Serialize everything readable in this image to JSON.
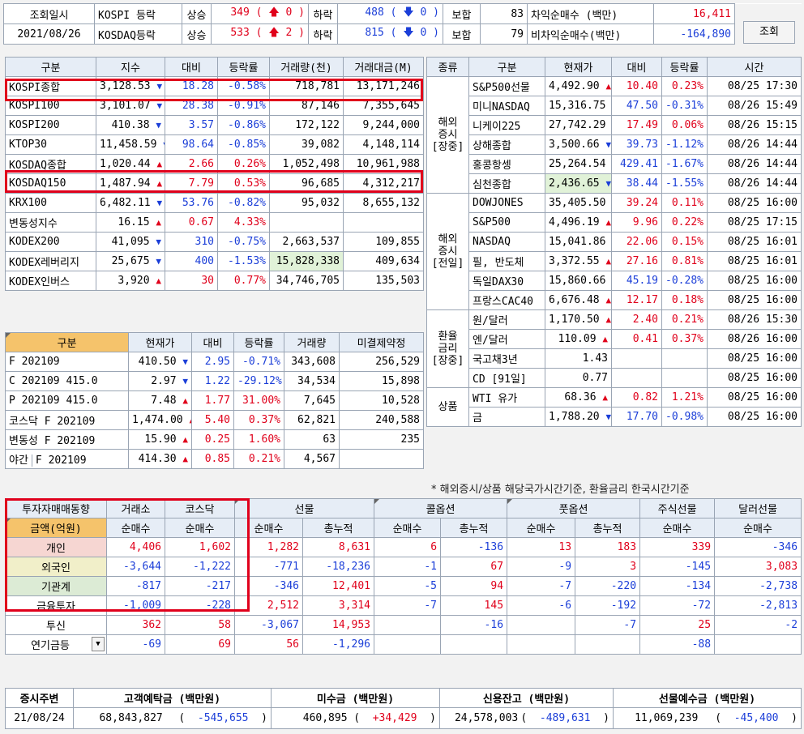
{
  "top": {
    "rows": [
      {
        "label": "조회일시",
        "name": "KOSPI 등락",
        "up_label": "상승",
        "up": "349",
        "up_ch": "0",
        "down_label": "하락",
        "down": "488",
        "down_ch": "0",
        "flat_label": "보합",
        "flat": "83",
        "arb_label": "차익순매수 (백만)",
        "arb": "16,411"
      },
      {
        "label": "2021/08/26",
        "name": "KOSDAQ등락",
        "up_label": "상승",
        "up": "533",
        "up_ch": "2",
        "down_label": "하락",
        "down": "815",
        "down_ch": "0",
        "flat_label": "보합",
        "flat": "79",
        "arb_label": "비차익순매수(백만)",
        "arb": "-164,890"
      }
    ],
    "query_btn": "조회"
  },
  "idx": {
    "headers": [
      "구분",
      "지수",
      "대비",
      "등락률",
      "거래량(천)",
      "거래대금(M)"
    ],
    "rows": [
      {
        "n": "KOSPI종합",
        "v": "3,128.53",
        "d": "dn",
        "c": "18.28",
        "r": "-0.58%",
        "vol": "718,781",
        "amt": "13,171,246"
      },
      {
        "n": "KOSPI100",
        "v": "3,101.07",
        "d": "dn",
        "c": "28.38",
        "r": "-0.91%",
        "vol": "87,146",
        "amt": "7,355,645"
      },
      {
        "n": "KOSPI200",
        "v": "410.38",
        "d": "dn",
        "c": "3.57",
        "r": "-0.86%",
        "vol": "172,122",
        "amt": "9,244,000"
      },
      {
        "n": "KTOP30",
        "v": "11,458.59",
        "d": "dn",
        "c": "98.64",
        "r": "-0.85%",
        "vol": "39,082",
        "amt": "4,148,114"
      },
      {
        "n": "KOSDAQ종합",
        "v": "1,020.44",
        "d": "up",
        "c": "2.66",
        "r": "0.26%",
        "vol": "1,052,498",
        "amt": "10,961,988"
      },
      {
        "n": "KOSDAQ150",
        "v": "1,487.94",
        "d": "up",
        "c": "7.79",
        "r": "0.53%",
        "vol": "96,685",
        "amt": "4,312,217"
      },
      {
        "n": "KRX100",
        "v": "6,482.11",
        "d": "dn",
        "c": "53.76",
        "r": "-0.82%",
        "vol": "95,032",
        "amt": "8,655,132"
      },
      {
        "n": "변동성지수",
        "v": "16.15",
        "d": "up",
        "c": "0.67",
        "r": "4.33%",
        "vol": "",
        "amt": ""
      },
      {
        "n": "KODEX200",
        "v": "41,095",
        "d": "dn",
        "c": "310",
        "r": "-0.75%",
        "vol": "2,663,537",
        "amt": "109,855"
      },
      {
        "n": "KODEX레버리지",
        "v": "25,675",
        "d": "dn",
        "c": "400",
        "r": "-1.53%",
        "vol": "15,828,338",
        "amt": "409,634"
      },
      {
        "n": "KODEX인버스",
        "v": "3,920",
        "d": "up",
        "c": "30",
        "r": "0.77%",
        "vol": "34,746,705",
        "amt": "135,503"
      }
    ]
  },
  "fut": {
    "headers": [
      "구분",
      "현재가",
      "대비",
      "등락률",
      "거래량",
      "미결제약정"
    ],
    "rows": [
      {
        "n": "F 202109",
        "v": "410.50",
        "d": "dn",
        "c": "2.95",
        "r": "-0.71%",
        "vol": "343,608",
        "oi": "256,529"
      },
      {
        "n": "C 202109 415.0",
        "v": "2.97",
        "d": "dn",
        "c": "1.22",
        "r": "-29.12%",
        "vol": "34,534",
        "oi": "15,898"
      },
      {
        "n": "P 202109 415.0",
        "v": "7.48",
        "d": "up",
        "c": "1.77",
        "r": "31.00%",
        "vol": "7,645",
        "oi": "10,528"
      },
      {
        "n": "코스닥 F 202109",
        "v": "1,474.00",
        "d": "up",
        "c": "5.40",
        "r": "0.37%",
        "vol": "62,821",
        "oi": "240,588"
      },
      {
        "n": "변동성 F 202109",
        "v": "15.90",
        "d": "up",
        "c": "0.25",
        "r": "1.60%",
        "vol": "63",
        "oi": "235"
      },
      {
        "n0": "야간",
        "n": "F 202109",
        "v": "414.30",
        "d": "up",
        "c": "0.85",
        "r": "0.21%",
        "vol": "4,567",
        "oi": ""
      }
    ]
  },
  "world": {
    "headers": [
      "종류",
      "구분",
      "현재가",
      "대비",
      "등락률",
      "시간"
    ],
    "groups": [
      {
        "g": "해외\n증시\n[장중]",
        "span": 6
      },
      {
        "g": "해외\n증시\n[전일]",
        "span": 6
      },
      {
        "g": "환율\n금리\n[장중]",
        "span": 4
      },
      {
        "g": "상품",
        "span": 2
      }
    ],
    "rows": [
      {
        "n": "S&P500선물",
        "v": "4,492.90",
        "d": "up",
        "c": "10.40",
        "r": "0.23%",
        "t": "08/25 17:30"
      },
      {
        "n": "미니NASDAQ",
        "v": "15,316.75",
        "d": "dn",
        "c": "47.50",
        "r": "-0.31%",
        "t": "08/26 15:49"
      },
      {
        "n": "니케이225",
        "v": "27,742.29",
        "d": "up",
        "c": "17.49",
        "r": "0.06%",
        "t": "08/26 15:15"
      },
      {
        "n": "상해종합",
        "v": "3,500.66",
        "d": "dn",
        "c": "39.73",
        "r": "-1.12%",
        "t": "08/26 14:44"
      },
      {
        "n": "홍콩항셍",
        "v": "25,264.54",
        "d": "dn",
        "c": "429.41",
        "r": "-1.67%",
        "t": "08/26 14:44"
      },
      {
        "n": "심천종합",
        "v": "2,436.65",
        "d": "dn",
        "c": "38.44",
        "r": "-1.55%",
        "t": "08/26 14:44"
      },
      {
        "n": "DOWJONES",
        "v": "35,405.50",
        "d": "up",
        "c": "39.24",
        "r": "0.11%",
        "t": "08/25 16:00"
      },
      {
        "n": "S&P500",
        "v": "4,496.19",
        "d": "up",
        "c": "9.96",
        "r": "0.22%",
        "t": "08/25 17:15"
      },
      {
        "n": "NASDAQ",
        "v": "15,041.86",
        "d": "up",
        "c": "22.06",
        "r": "0.15%",
        "t": "08/25 16:01"
      },
      {
        "n": "필, 반도체",
        "v": "3,372.55",
        "d": "up",
        "c": "27.16",
        "r": "0.81%",
        "t": "08/25 16:01"
      },
      {
        "n": "독일DAX30",
        "v": "15,860.66",
        "d": "dn",
        "c": "45.19",
        "r": "-0.28%",
        "t": "08/25 16:00"
      },
      {
        "n": "프랑스CAC40",
        "v": "6,676.48",
        "d": "up",
        "c": "12.17",
        "r": "0.18%",
        "t": "08/25 16:00"
      },
      {
        "n": "원/달러",
        "v": "1,170.50",
        "d": "up",
        "c": "2.40",
        "r": "0.21%",
        "t": "08/26 15:30"
      },
      {
        "n": "엔/달러",
        "v": "110.09",
        "d": "up",
        "c": "0.41",
        "r": "0.37%",
        "t": "08/26 16:00"
      },
      {
        "n": "국고채3년",
        "v": "1.43",
        "d": "",
        "c": "",
        "r": "",
        "t": "08/25 16:00"
      },
      {
        "n": "CD [91일]",
        "v": "0.77",
        "d": "",
        "c": "",
        "r": "",
        "t": "08/25 16:00"
      },
      {
        "n": "WTI 유가",
        "v": "68.36",
        "d": "up",
        "c": "0.82",
        "r": "1.21%",
        "t": "08/25 16:00"
      },
      {
        "n": "금",
        "v": "1,788.20",
        "d": "dn",
        "c": "17.70",
        "r": "-0.98%",
        "t": "08/25 16:00"
      }
    ],
    "note": "* 해외증시/상품 해당국가시간기준, 환율금리 한국시간기준"
  },
  "inv": {
    "h1": [
      "투자자매매동향",
      "거래소",
      "코스닥",
      "선물",
      "콜옵션",
      "풋옵션",
      "주식선물",
      "달러선물"
    ],
    "h2": [
      "금액(억원)",
      "순매수",
      "순매수",
      "순매수",
      "총누적",
      "순매수",
      "총누적",
      "순매수",
      "총누적",
      "순매수",
      "순매수"
    ],
    "rows": [
      {
        "n": "개인",
        "cls": "rowp",
        "v": [
          "4,406",
          "1,602",
          "1,282",
          "8,631",
          "6",
          "-136",
          "13",
          "183",
          "339",
          "-346"
        ]
      },
      {
        "n": "외국인",
        "cls": "rowy",
        "v": [
          "-3,644",
          "-1,222",
          "-771",
          "-18,236",
          "-1",
          "67",
          "-9",
          "3",
          "-145",
          "3,083"
        ]
      },
      {
        "n": "기관계",
        "cls": "rowg",
        "v": [
          "-817",
          "-217",
          "-346",
          "12,401",
          "-5",
          "94",
          "-7",
          "-220",
          "-134",
          "-2,738"
        ]
      },
      {
        "n": "금융투자",
        "cls": "",
        "v": [
          "-1,009",
          "-228",
          "2,512",
          "3,314",
          "-7",
          "145",
          "-6",
          "-192",
          "-72",
          "-2,813"
        ]
      },
      {
        "n": "투신",
        "cls": "",
        "v": [
          "362",
          "58",
          "-3,067",
          "14,953",
          "",
          "-16",
          "",
          "-7",
          "25",
          "-2"
        ]
      },
      {
        "n": "연기금등",
        "cls": "",
        "v": [
          "-69",
          "69",
          "56",
          "-1,296",
          "",
          "",
          "",
          "",
          "-88",
          ""
        ]
      }
    ]
  },
  "bot": {
    "headers": [
      "증시주변",
      "고객예탁금 (백만원)",
      "미수금 (백만원)",
      "신용잔고 (백만원)",
      "선물예수금 (백만원)"
    ],
    "date": "21/08/24",
    "deposit": "68,843,827",
    "deposit_ch": "-545,655",
    "unpaid": "460,895",
    "unpaid_ch": "+34,429",
    "credit": "24,578,003",
    "credit_ch": "-489,631",
    "fdep": "11,069,239",
    "fdep_ch": "-45,400"
  }
}
